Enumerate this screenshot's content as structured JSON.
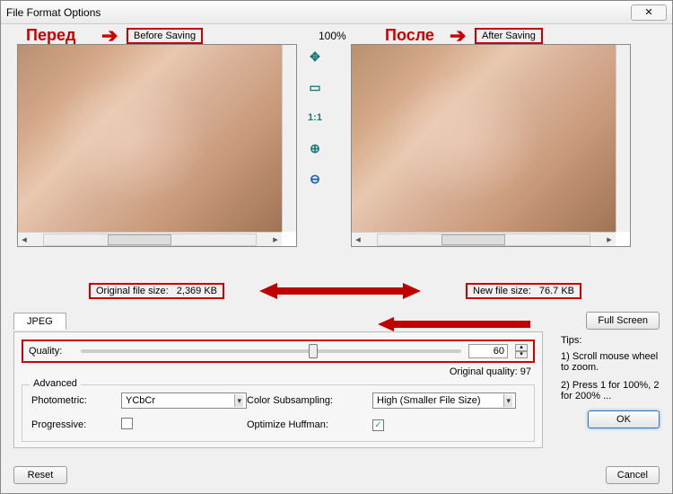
{
  "window": {
    "title": "File Format Options"
  },
  "annotations": {
    "before": "Перед",
    "after": "После",
    "before_box": "Before Saving",
    "after_box": "After Saving"
  },
  "zoom_label": "100%",
  "toolbar": {
    "navigate": "✥",
    "fit": "▭",
    "ratio": "1:1",
    "zoom_in": "⊕",
    "zoom_out": "⊖"
  },
  "file_sizes": {
    "original_label": "Original file size:",
    "original_value": "2,369 KB",
    "new_label": "New file size:",
    "new_value": "76.7 KB"
  },
  "tab": {
    "jpeg": "JPEG"
  },
  "buttons": {
    "fullscreen": "Full Screen",
    "ok": "OK",
    "cancel": "Cancel",
    "reset": "Reset"
  },
  "quality": {
    "label": "Quality:",
    "value": "60",
    "slider_percent": 60,
    "original_label": "Original quality:",
    "original_value": "97"
  },
  "advanced": {
    "legend": "Advanced",
    "photometric_label": "Photometric:",
    "photometric_value": "YCbCr",
    "subsampling_label": "Color Subsampling:",
    "subsampling_value": "High (Smaller File Size)",
    "progressive_label": "Progressive:",
    "progressive_checked": false,
    "huffman_label": "Optimize Huffman:",
    "huffman_checked": true
  },
  "tips": {
    "title": "Tips:",
    "line1": "1) Scroll mouse wheel to zoom.",
    "line2": "2) Press 1 for 100%, 2 for 200% ..."
  }
}
